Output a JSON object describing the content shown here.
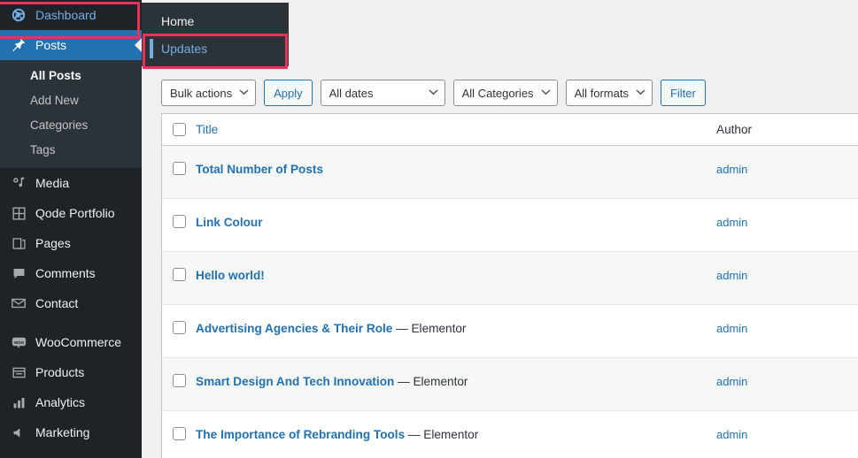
{
  "sidebar": {
    "items": [
      {
        "label": "Dashboard",
        "icon": "dashboard-icon",
        "state": "open-flyout"
      },
      {
        "label": "Posts",
        "icon": "pin-icon",
        "state": "active"
      },
      {
        "label": "Media",
        "icon": "media-icon",
        "state": "normal"
      },
      {
        "label": "Qode Portfolio",
        "icon": "grid-icon",
        "state": "normal"
      },
      {
        "label": "Pages",
        "icon": "pages-icon",
        "state": "normal"
      },
      {
        "label": "Comments",
        "icon": "comment-icon",
        "state": "normal"
      },
      {
        "label": "Contact",
        "icon": "envelope-icon",
        "state": "normal"
      },
      {
        "label": "WooCommerce",
        "icon": "woo-icon",
        "state": "normal"
      },
      {
        "label": "Products",
        "icon": "products-icon",
        "state": "normal"
      },
      {
        "label": "Analytics",
        "icon": "analytics-icon",
        "state": "normal"
      },
      {
        "label": "Marketing",
        "icon": "megaphone-icon",
        "state": "normal"
      }
    ],
    "posts_submenu": [
      {
        "label": "All Posts",
        "current": true
      },
      {
        "label": "Add New",
        "current": false
      },
      {
        "label": "Categories",
        "current": false
      },
      {
        "label": "Tags",
        "current": false
      }
    ]
  },
  "flyout": {
    "items": [
      {
        "label": "Home",
        "current": false
      },
      {
        "label": "Updates",
        "current": true
      }
    ]
  },
  "toolbar": {
    "bulk_actions": "Bulk actions",
    "apply": "Apply",
    "all_dates": "All dates",
    "all_categories": "All Categories",
    "all_formats": "All formats",
    "filter": "Filter"
  },
  "table": {
    "columns": {
      "title": "Title",
      "author": "Author"
    },
    "rows": [
      {
        "title": "Total Number of Posts",
        "suffix": "",
        "author": "admin"
      },
      {
        "title": "Link Colour",
        "suffix": "",
        "author": "admin"
      },
      {
        "title": "Hello world!",
        "suffix": "",
        "author": "admin"
      },
      {
        "title": "Advertising Agencies & Their Role",
        "suffix": " — Elementor",
        "author": "admin"
      },
      {
        "title": "Smart Design And Tech Innovation",
        "suffix": " — Elementor",
        "author": "admin"
      },
      {
        "title": "The Importance of Rebranding Tools",
        "suffix": " — Elementor",
        "author": "admin"
      }
    ]
  },
  "colors": {
    "sidebar_bg": "#1d2327",
    "submenu_bg": "#2c3338",
    "active_blue": "#2271b1",
    "link_blue": "#2271b1",
    "highlight_red": "#e8325a",
    "dashboard_text": "#72aee6"
  }
}
